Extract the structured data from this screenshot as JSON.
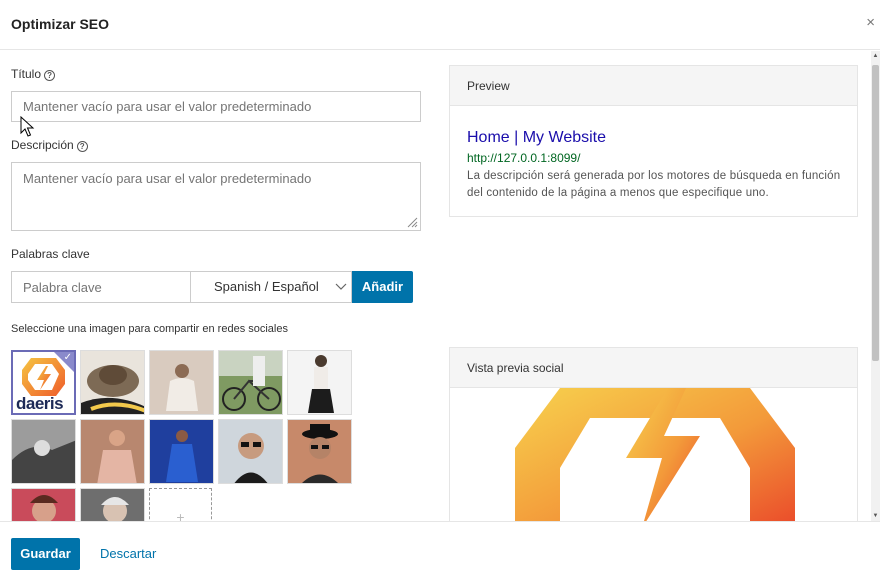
{
  "modal": {
    "title": "Optimizar SEO",
    "close_label": "×"
  },
  "form": {
    "title_label": "Título",
    "title_placeholder": "Mantener vacío para usar el valor predeterminado",
    "title_value": "",
    "description_label": "Descripción",
    "description_placeholder": "Mantener vacío para usar el valor predeterminado",
    "description_value": "",
    "help_glyph": "?",
    "keywords_label": "Palabras clave",
    "keyword_placeholder": "Palabra clave",
    "language_selected": "Spanish / Español",
    "add_label": "Añadir",
    "social_image_label": "Seleccione una imagen para compartir en redes sociales"
  },
  "images": [
    {
      "name": "daeris-logo",
      "selected": true,
      "text": "daeris"
    },
    {
      "name": "photo-hat",
      "selected": false
    },
    {
      "name": "photo-woman-sitting",
      "selected": false
    },
    {
      "name": "photo-bicycle",
      "selected": false
    },
    {
      "name": "photo-woman-standing",
      "selected": false
    },
    {
      "name": "photo-bw-woman",
      "selected": false
    },
    {
      "name": "photo-woman-pink",
      "selected": false
    },
    {
      "name": "photo-woman-blue-dress",
      "selected": false
    },
    {
      "name": "photo-man-sunglasses",
      "selected": false
    },
    {
      "name": "photo-man-hat",
      "selected": false
    },
    {
      "name": "photo-woman-red",
      "selected": false
    },
    {
      "name": "photo-old-woman",
      "selected": false
    }
  ],
  "preview": {
    "header": "Preview",
    "title": "Home | My Website",
    "url": "http://127.0.0.1:8099/",
    "description": "La descripción será generada por los motores de búsqueda en función del contenido de la página a menos que especifique uno."
  },
  "social_preview": {
    "header": "Vista previa social"
  },
  "footer": {
    "save_label": "Guardar",
    "discard_label": "Descartar"
  },
  "colors": {
    "primary": "#0073aa",
    "link": "#1a0dab",
    "url": "#006621",
    "selected": "#8a8acb"
  }
}
